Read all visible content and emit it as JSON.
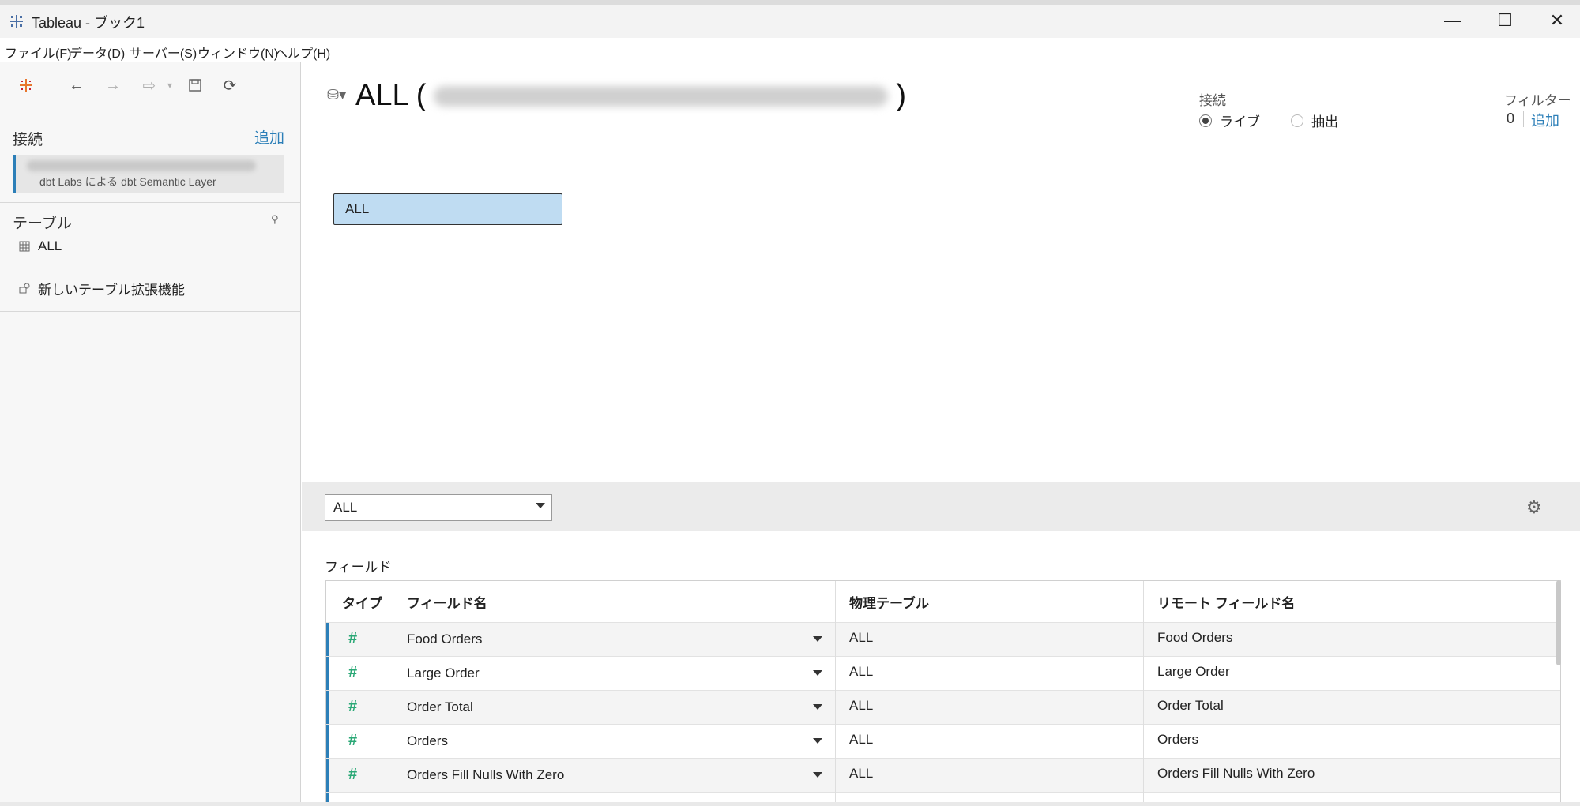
{
  "window": {
    "title": "Tableau - ブック1",
    "controls": {
      "minimize": "—",
      "maximize": "☐",
      "close": "✕"
    }
  },
  "menu": [
    "ファイル(F)",
    "データ(D)",
    "サーバー(S)",
    "ウィンドウ(N)",
    "ヘルプ(H)"
  ],
  "toolbar": {
    "icons": [
      "tableau-logo-icon",
      "back-arrow-icon",
      "forward-arrow-icon",
      "pause-updates-icon",
      "save-icon",
      "refresh-icon"
    ]
  },
  "sidebar": {
    "connections_title": "接続",
    "add_label": "追加",
    "connection_sub": "dbt Labs による dbt Semantic Layer",
    "tables_title": "テーブル",
    "table_item": "ALL",
    "new_extension": "新しいテーブル拡張機能"
  },
  "datasource": {
    "title_prefix": "ALL (",
    "title_suffix": ")",
    "connection_label": "接続",
    "live_label": "ライブ",
    "extract_label": "抽出",
    "selected_mode": "ライブ",
    "filter_label": "フィルター",
    "filter_count": "0",
    "filter_add": "追加",
    "canvas_table": "ALL"
  },
  "grid_bar": {
    "selected_table": "ALL"
  },
  "fields": {
    "section_label": "フィールド",
    "headers": [
      "タイプ",
      "フィールド名",
      "物理テーブル",
      "リモート フィールド名"
    ],
    "rows": [
      {
        "type": "#",
        "name": "Food Orders",
        "table": "ALL",
        "remote": "Food Orders"
      },
      {
        "type": "#",
        "name": "Large Order",
        "table": "ALL",
        "remote": "Large Order"
      },
      {
        "type": "#",
        "name": "Order Total",
        "table": "ALL",
        "remote": "Order Total"
      },
      {
        "type": "#",
        "name": "Orders",
        "table": "ALL",
        "remote": "Orders"
      },
      {
        "type": "#",
        "name": "Orders Fill Nulls With Zero",
        "table": "ALL",
        "remote": "Orders Fill Nulls With Zero"
      }
    ]
  },
  "colors": {
    "accent": "#2c7fb8",
    "number_type": "#2aa876",
    "table_box": "#bfdcf2"
  }
}
